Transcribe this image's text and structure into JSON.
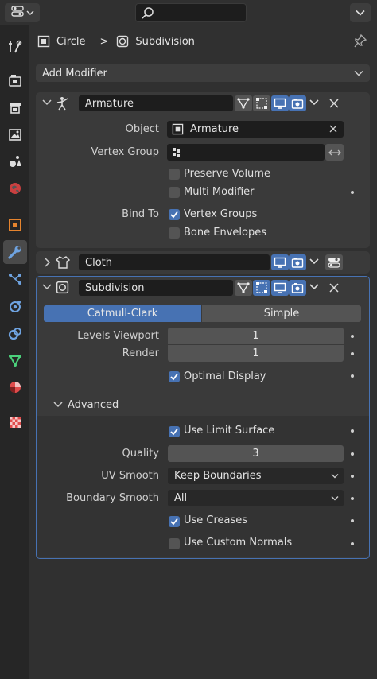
{
  "colors": {
    "accent": "#4772b3",
    "panel_bg": "#3a3a3a",
    "field_bg": "#545454",
    "dark_field_bg": "#1d1d1d",
    "modifier_icon": "#6fa3e0",
    "object_icon": "#e5842e",
    "shader_icon": "#e04b4b"
  },
  "header": {
    "editor_type_icon": "properties-editor-icon",
    "search_placeholder": "",
    "options_icon": "chevron-down-icon"
  },
  "tabs": [
    {
      "name": "tool-tab",
      "icon": "tool-icon"
    },
    {
      "name": "render-tab",
      "icon": "camera-back-icon"
    },
    {
      "name": "output-tab",
      "icon": "printer-icon"
    },
    {
      "name": "view-layer-tab",
      "icon": "image-icon"
    },
    {
      "name": "scene-tab",
      "icon": "scene-icon"
    },
    {
      "name": "world-tab",
      "icon": "world-icon"
    },
    {
      "name": "object-tab",
      "icon": "object-icon"
    },
    {
      "name": "modifiers-tab",
      "icon": "wrench-icon",
      "active": true
    },
    {
      "name": "particles-tab",
      "icon": "particles-icon"
    },
    {
      "name": "physics-tab",
      "icon": "physics-icon"
    },
    {
      "name": "constraints-tab",
      "icon": "constraints-icon"
    },
    {
      "name": "data-tab",
      "icon": "mesh-data-icon"
    },
    {
      "name": "material-tab",
      "icon": "material-icon"
    },
    {
      "name": "texture-tab",
      "icon": "checker-icon"
    }
  ],
  "breadcrumb": {
    "object": "Circle",
    "separator": ">",
    "modifier": "Subdivision",
    "pin_icon": "pin-icon"
  },
  "add_modifier": {
    "label": "Add Modifier"
  },
  "armature": {
    "name": "Armature",
    "object_label": "Object",
    "object_value": "Armature",
    "vertex_group_label": "Vertex Group",
    "vertex_group_value": "",
    "preserve_volume": {
      "label": "Preserve Volume",
      "checked": false
    },
    "multi_modifier": {
      "label": "Multi Modifier",
      "checked": false
    },
    "bind_to_label": "Bind To",
    "vertex_groups": {
      "label": "Vertex Groups",
      "checked": true
    },
    "bone_envelopes": {
      "label": "Bone Envelopes",
      "checked": false
    }
  },
  "cloth": {
    "name": "Cloth"
  },
  "subdivision": {
    "name": "Subdivision",
    "mode_catmull": "Catmull-Clark",
    "mode_simple": "Simple",
    "levels_viewport_label": "Levels Viewport",
    "levels_viewport": "1",
    "render_label": "Render",
    "render": "1",
    "optimal_display": {
      "label": "Optimal Display",
      "checked": true
    },
    "advanced_label": "Advanced",
    "use_limit_surface": {
      "label": "Use Limit Surface",
      "checked": true
    },
    "quality_label": "Quality",
    "quality": "3",
    "uv_smooth_label": "UV Smooth",
    "uv_smooth": "Keep Boundaries",
    "boundary_smooth_label": "Boundary Smooth",
    "boundary_smooth": "All",
    "use_creases": {
      "label": "Use Creases",
      "checked": true
    },
    "use_custom_normals": {
      "label": "Use Custom Normals",
      "checked": false
    }
  }
}
